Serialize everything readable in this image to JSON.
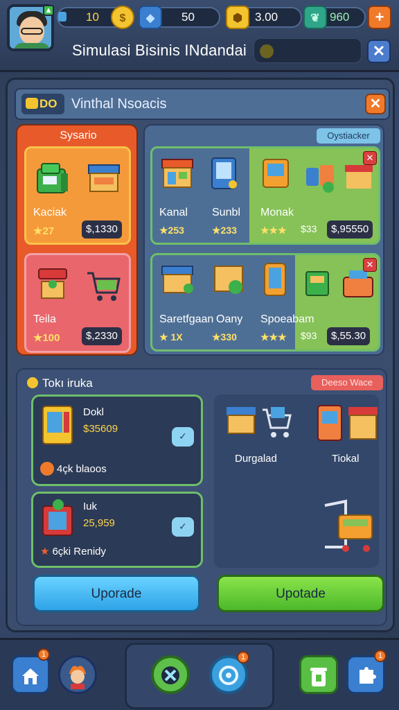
{
  "topbar": {
    "coins": "10",
    "gems": "50",
    "gold": "3.00",
    "leaves": "960",
    "plus_label": "+",
    "title": "Simulasi Bisinis INdandai",
    "close_label": "✕"
  },
  "panel": {
    "badge": "DO",
    "title": "Vinthal Nsoacis",
    "close_label": "✕",
    "left_column": {
      "label": "Sysario",
      "cards": [
        {
          "name": "Kaciak",
          "stars": "★27",
          "price": "$,1330"
        },
        {
          "name": "Teila",
          "stars": "★100",
          "price": "$,2330"
        }
      ]
    },
    "right_column": {
      "tag": "Oystiacker",
      "row1": {
        "items": [
          {
            "name": "Kanal",
            "stars": "★253"
          },
          {
            "name": "Sunbl",
            "stars": "★233"
          },
          {
            "name": "Monak",
            "stars": "★★★"
          }
        ],
        "price_a": "$33",
        "price_b": "$,95550",
        "close": "✕"
      },
      "row2": {
        "items": [
          {
            "name": "Saretfgaan",
            "stars": "★ 1X"
          },
          {
            "name": "Oany",
            "stars": "★330"
          },
          {
            "name": "Spoeabam",
            "stars": "★★★"
          }
        ],
        "price_a": "$93",
        "price_b": "$,55.30",
        "close": "✕"
      }
    }
  },
  "lower": {
    "title": "Tokı iruka",
    "tag": "Deeso Wace",
    "items": [
      {
        "name": "Dokl",
        "value": "$35609",
        "footer": "4çk  blaoos",
        "bubble": "✓"
      },
      {
        "name": "Iuk",
        "value": "25,959",
        "footer": "6çki  Renidy",
        "bubble": "✓"
      }
    ],
    "right": {
      "label_left": "Durgalad",
      "label_right": "Tiokal"
    },
    "upgrade_left": "Uporade",
    "upgrade_right": "Upotade"
  },
  "bottomnav": {
    "home_badge": "1",
    "center_badge": "1",
    "right_badge": "1"
  }
}
